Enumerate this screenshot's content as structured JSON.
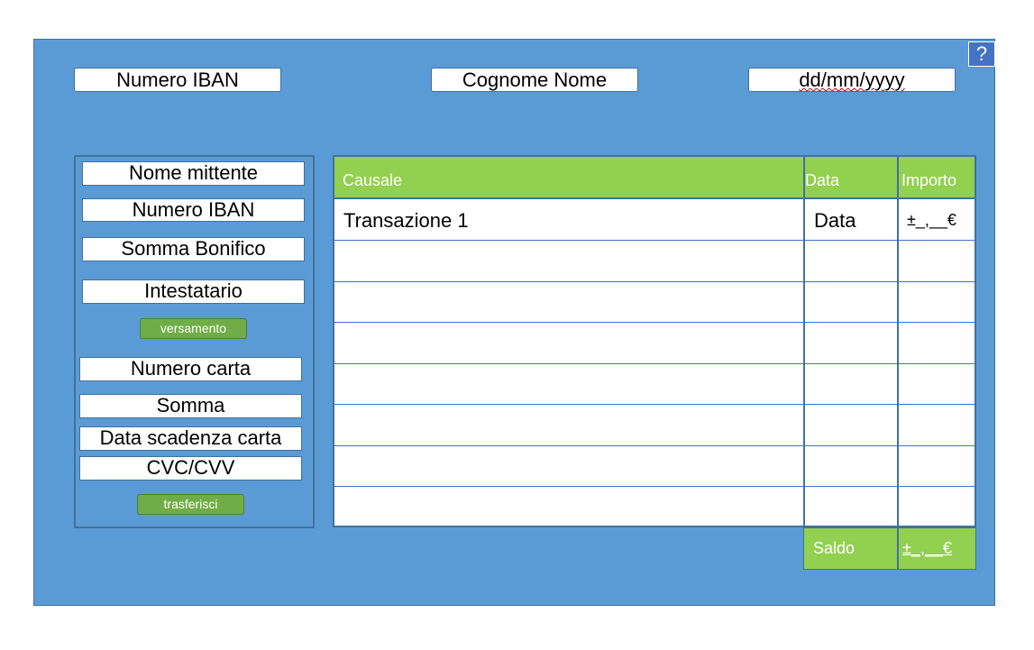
{
  "header": {
    "help": "?",
    "iban": "Numero IBAN",
    "name": "Cognome Nome",
    "date": "dd/mm/yyyy"
  },
  "left_panel": {
    "transfer": {
      "sender_name": "Nome mittente",
      "iban": "Numero IBAN",
      "amount": "Somma Bonifico",
      "holder": "Intestatario",
      "button": "versamento"
    },
    "card": {
      "card_number": "Numero carta",
      "amount": "Somma",
      "expiry": "Data scadenza carta",
      "cvc": "CVC/CVV",
      "button": "trasferisci"
    }
  },
  "table": {
    "columns": [
      "Causale",
      "Data",
      "Importo"
    ],
    "rows": [
      {
        "causale": "Transazione 1",
        "data": "Data",
        "importo": "±_,__€"
      }
    ]
  },
  "balance": {
    "label": "Saldo",
    "value": "±_,__€"
  },
  "colors": {
    "background": "#5b9bd5",
    "header_green": "#92d050",
    "button_green": "#70ad47",
    "border": "#41719c",
    "help_button": "#4472c4"
  }
}
